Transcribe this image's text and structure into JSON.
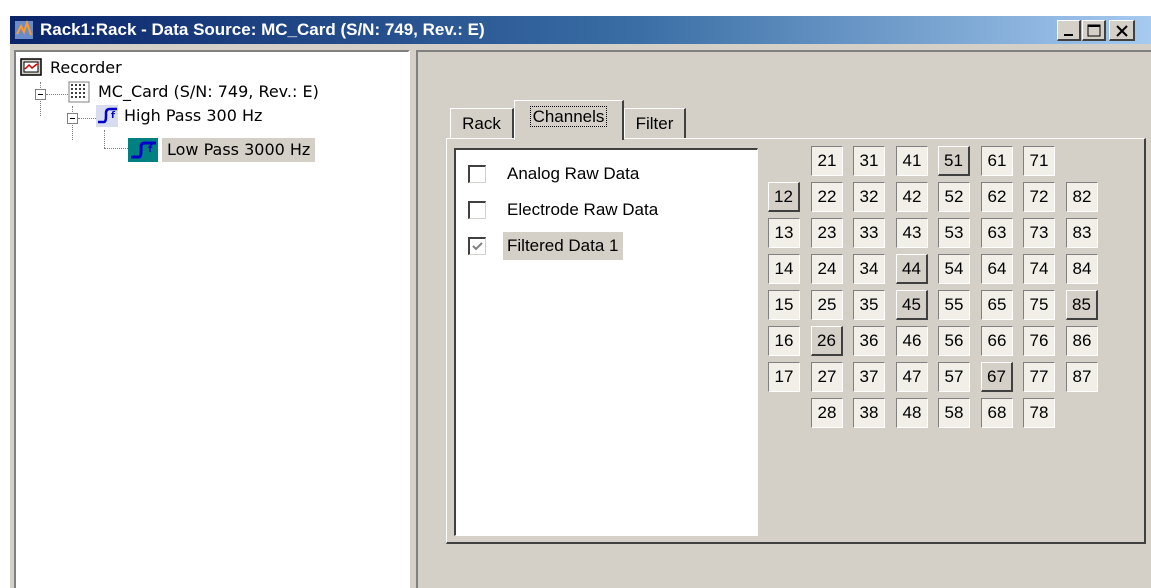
{
  "window": {
    "title": "Rack1:Rack - Data Source: MC_Card (S/N: 749, Rev.: E)",
    "controls": [
      "minimize",
      "maximize",
      "close"
    ]
  },
  "tree": {
    "root": {
      "label": "Recorder",
      "icon": "recorder-icon"
    },
    "card": {
      "label": "MC_Card (S/N: 749, Rev.: E)",
      "icon": "electrode-grid-icon",
      "expanded": true
    },
    "highpass": {
      "label": "High Pass 300 Hz",
      "icon": "filter-icon",
      "expanded": true
    },
    "lowpass": {
      "label": "Low Pass 3000 Hz",
      "icon": "filter-icon",
      "selected": true
    }
  },
  "tabs": {
    "rack": "Rack",
    "channels": "Channels",
    "filter": "Filter",
    "active": "Channels"
  },
  "checklist": [
    {
      "label": "Analog Raw Data",
      "checked": false,
      "enabled": true
    },
    {
      "label": "Electrode Raw Data",
      "checked": false,
      "enabled": true
    },
    {
      "label": "Filtered Data 1",
      "checked": true,
      "enabled": false,
      "selected": true
    }
  ],
  "channel_grid": {
    "rows": [
      [
        null,
        "21",
        "31",
        "41",
        "51",
        "61",
        "71",
        null
      ],
      [
        "12",
        "22",
        "32",
        "42",
        "52",
        "62",
        "72",
        "82"
      ],
      [
        "13",
        "23",
        "33",
        "43",
        "53",
        "63",
        "73",
        "83"
      ],
      [
        "14",
        "24",
        "34",
        "44",
        "54",
        "64",
        "74",
        "84"
      ],
      [
        "15",
        "25",
        "35",
        "45",
        "55",
        "65",
        "75",
        "85"
      ],
      [
        "16",
        "26",
        "36",
        "46",
        "56",
        "66",
        "76",
        "86"
      ],
      [
        "17",
        "27",
        "37",
        "47",
        "57",
        "67",
        "77",
        "87"
      ],
      [
        null,
        "28",
        "38",
        "48",
        "58",
        "68",
        "78",
        null
      ]
    ],
    "pressed": [
      "51",
      "12",
      "44",
      "45",
      "85",
      "26",
      "67"
    ]
  },
  "colors": {
    "title_start": "#0a246a",
    "title_end": "#a6caf0",
    "face": "#d4d0c8",
    "filter_icon": "#0000cc",
    "selected_icon_bg": "#008080"
  }
}
